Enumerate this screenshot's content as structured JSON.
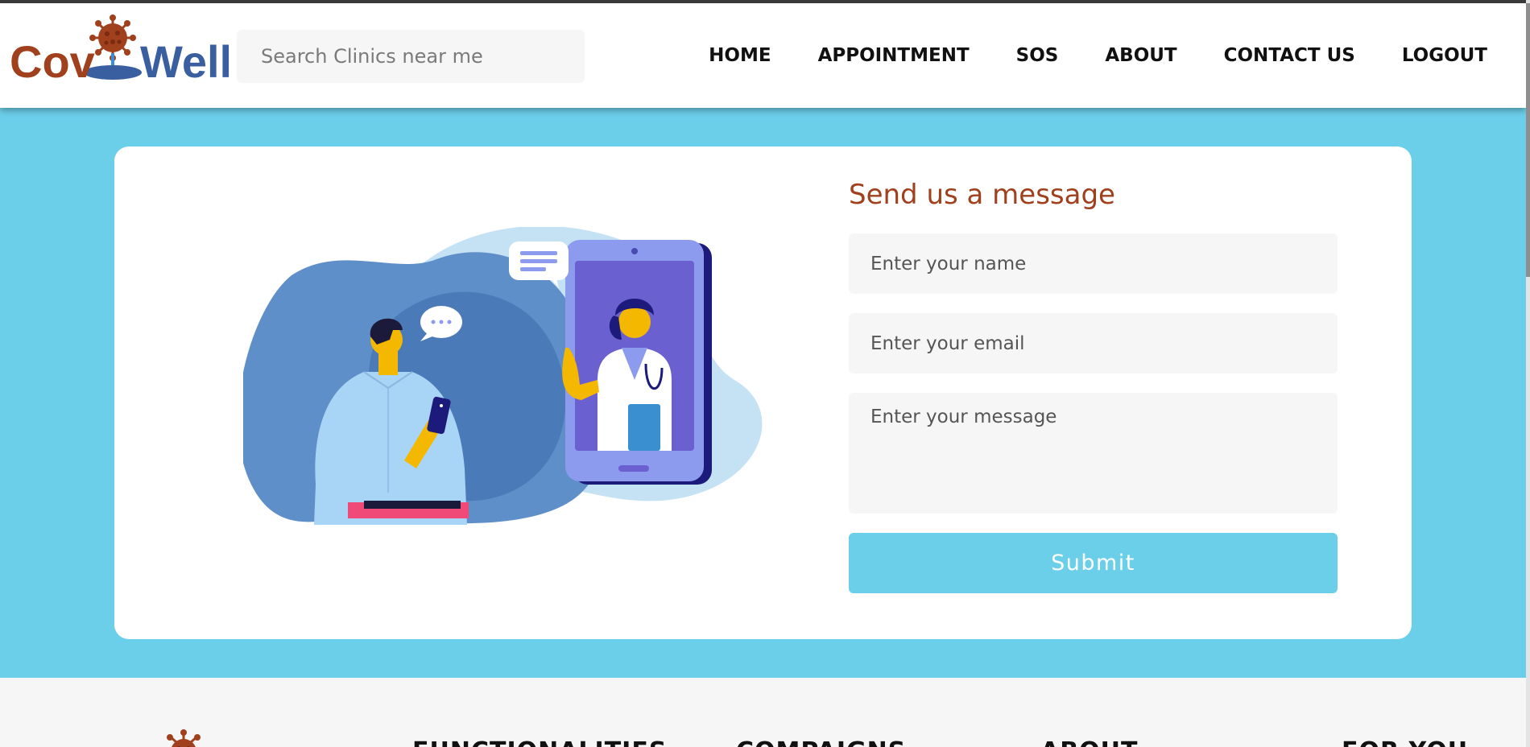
{
  "brand": {
    "name_part1": "Cov",
    "name_part2": "Well",
    "colors": {
      "primary_red": "#a0401c",
      "primary_blue": "#3a5fa0",
      "accent_cyan": "#6ccfea"
    }
  },
  "search": {
    "placeholder": "Search Clinics near me"
  },
  "nav": {
    "items": [
      "HOME",
      "APPOINTMENT",
      "SOS",
      "ABOUT",
      "CONTACT US",
      "LOGOUT"
    ]
  },
  "contact_form": {
    "title": "Send us a message",
    "name_placeholder": "Enter your name",
    "email_placeholder": "Enter your email",
    "message_placeholder": "Enter your message",
    "submit_label": "Submit"
  },
  "illustration": {
    "icon": "doctor-video-consultation-illustration"
  },
  "footer": {
    "columns": [
      "FUNCTIONALITIES",
      "COMPAIGNS",
      "ABOUT",
      "FOR YOU"
    ]
  }
}
